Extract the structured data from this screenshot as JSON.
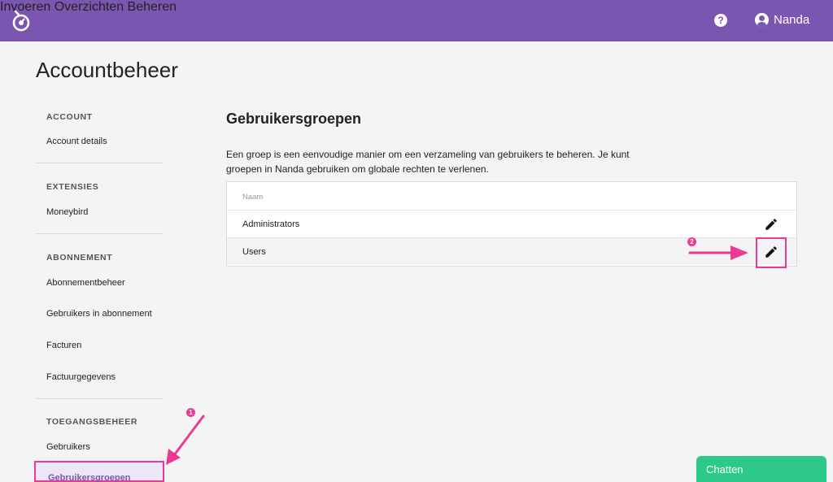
{
  "topbar": {
    "logo_icon": "stopwatch-icon",
    "nav": [
      "Invoeren",
      "Overzichten",
      "Beheren"
    ],
    "help_icon": "question-circle-icon",
    "help_glyph": "?",
    "user_icon": "user-circle-icon",
    "user_name": "Nanda",
    "color": "#7b56b0"
  },
  "page": {
    "title": "Accountbeheer"
  },
  "sidebar": {
    "sections": [
      {
        "heading": "ACCOUNT",
        "items": [
          "Account details"
        ]
      },
      {
        "heading": "EXTENSIES",
        "items": [
          "Moneybird"
        ]
      },
      {
        "heading": "ABONNEMENT",
        "items": [
          "Abonnementbeheer",
          "Gebruikers in abonnement",
          "Facturen",
          "Factuurgegevens"
        ]
      },
      {
        "heading": "TOEGANGSBEHEER",
        "items": [
          "Gebruikers",
          "Gebruikersgroepen"
        ]
      }
    ],
    "active_item": "Gebruikersgroepen"
  },
  "main": {
    "title": "Gebruikersgroepen",
    "description": "Een groep is een eenvoudige manier om een verzameling van gebruikers te beheren. Je kunt groepen in Nanda gebruiken om globale rechten te verlenen.",
    "table": {
      "column": "Naam",
      "rows": [
        "Administrators",
        "Users"
      ],
      "edit_icon": "pencil-icon"
    }
  },
  "annotations": {
    "step1": "1",
    "step2": "2",
    "color": "#ea3b94"
  },
  "chat": {
    "label": "Chatten",
    "color": "#2cc98b"
  }
}
